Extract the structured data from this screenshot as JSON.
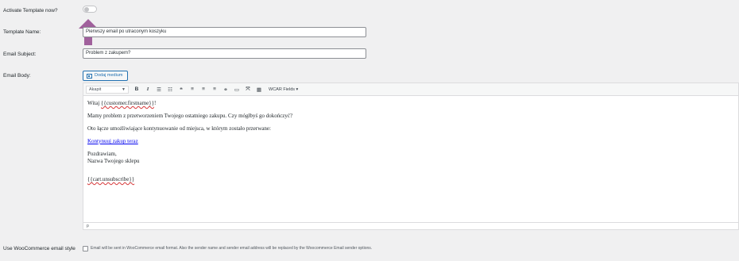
{
  "fields": {
    "activate_label": "Activate Template now?",
    "activate_enabled": false,
    "template_name_label": "Template Name:",
    "template_name_value": "Pierwszy email po utraconym koszyku",
    "email_subject_label": "Email Subject:",
    "email_subject_value": "Problem z zakupem?",
    "email_body_label": "Email Body:",
    "wc_style_label": "Use WooCommerce email style",
    "wc_style_checked": false,
    "wc_style_description": "Email will be sent in WooCommerce email format. Also the sender name and sender email address will be replaced by the Woocommerce Email sender options."
  },
  "editor": {
    "add_media_label": "Dodaj medium",
    "format_select_value": "Akapit",
    "toolbar_buttons": [
      "B",
      "I",
      "bullet-list",
      "numbered-list",
      "blockquote",
      "align-left",
      "align-center",
      "align-right",
      "link",
      "read-more",
      "fullscreen",
      "toolbar-toggle"
    ],
    "fields_menu_label": "WCAR Fields ▾",
    "body": {
      "greeting_prefix": "Witaj ",
      "greeting_tag": "{{customer.firstname}}",
      "greeting_suffix": "!",
      "line1": "Mamy problem z przetworzeniem Twojego ostatniego zakupu. Czy mógłbyś go dokończyć?",
      "line2": "Oto łącze umożliwiające kontynuowanie od miejsca, w którym zostało przerwane:",
      "continue_link": "Kontynuuj zakup teraz",
      "sign1": "Pozdrawiam,",
      "sign2": "Nazwa Twojego sklepu",
      "unsubscribe_tag": "{{cart.unsubscribe}}"
    },
    "status_path": "p"
  },
  "colors": {
    "annotation_arrow": "#a0609c",
    "link_blue": "#0000ee",
    "accent": "#2271b1"
  }
}
